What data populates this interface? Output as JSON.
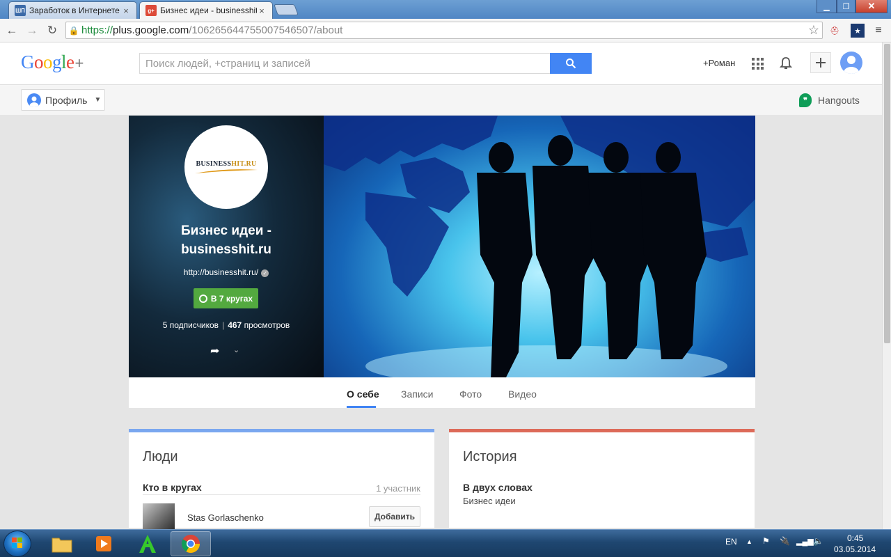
{
  "browser": {
    "tabs": [
      {
        "title": "Заработок в Интернете |",
        "favicon": "site-favicon",
        "active": false
      },
      {
        "title": "Бизнес идеи - businesshit",
        "favicon": "google-plus-favicon",
        "active": true
      }
    ],
    "url": {
      "scheme": "https://",
      "host": "plus.google.com",
      "path": "/106265644755007546507/about"
    }
  },
  "gplus": {
    "logo_text": "Google",
    "logo_plus": "+",
    "search_placeholder": "Поиск людей, +страниц и записей",
    "user_link": "+Роман",
    "profile_button": "Профиль",
    "hangouts_label": "Hangouts"
  },
  "profile": {
    "logo_text_main": "BUSINESS",
    "logo_text_accent": "HIT.RU",
    "name_line1": "Бизнес идеи -",
    "name_line2": "businesshit.ru",
    "url": "http://businesshit.ru/",
    "circles_button": "В 7 кругах",
    "followers": "5 подписчиков",
    "separator": "|",
    "views_num": "467",
    "views_label": "просмотров"
  },
  "profile_tabs": [
    {
      "label": "О себе",
      "active": true
    },
    {
      "label": "Записи",
      "active": false
    },
    {
      "label": "Фото",
      "active": false
    },
    {
      "label": "Видео",
      "active": false
    }
  ],
  "people_card": {
    "title": "Люди",
    "subtitle": "Кто в кругах",
    "count": "1 участник",
    "person_name": "Stas Gorlaschenko",
    "add_button": "Добавить"
  },
  "story_card": {
    "title": "История",
    "subtitle": "В двух словах",
    "value": "Бизнес идеи"
  },
  "taskbar": {
    "lang": "EN",
    "time": "0:45",
    "date": "03.05.2014"
  },
  "colors": {
    "google_blue": "#4285f4",
    "circles_green": "#53a93f",
    "people_accent": "#7aa7ef",
    "story_accent": "#dd6a59"
  }
}
